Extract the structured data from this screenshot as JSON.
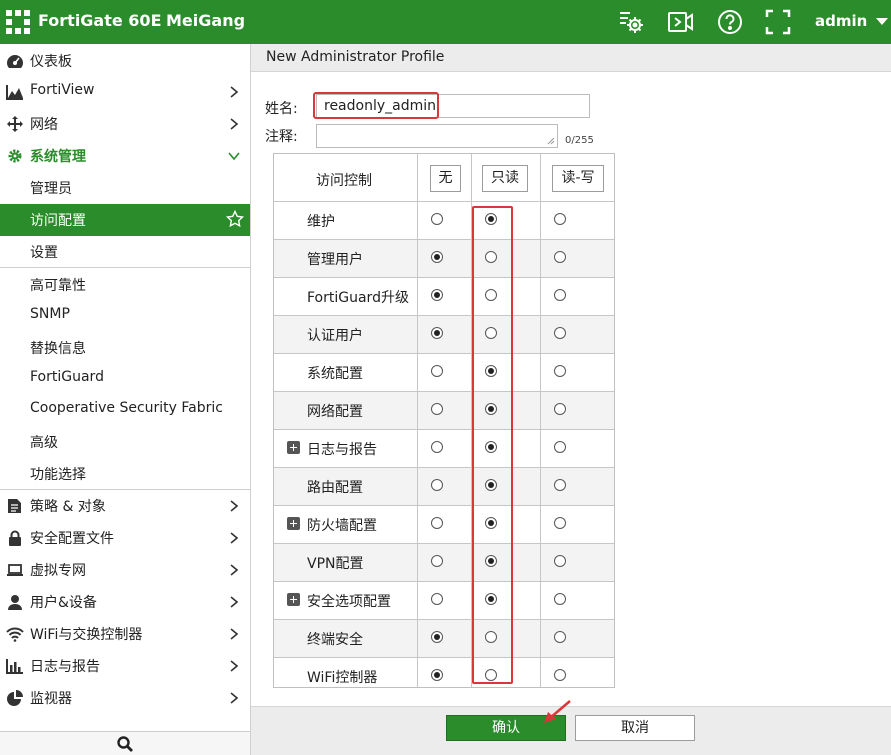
{
  "colors": {
    "brand": "#2a8c2a",
    "highlight": "#d9373a"
  },
  "topbar": {
    "product": "FortiGate 60E",
    "hostname": "MeiGang",
    "user": "admin",
    "icons": [
      "cli-console-icon",
      "fullscreen-video-icon",
      "help-icon",
      "expand-icon"
    ]
  },
  "sidebar": {
    "items": [
      {
        "label": "仪表板",
        "icon": "dashboard-icon",
        "chevron": false
      },
      {
        "label": "FortiView",
        "icon": "chart-icon",
        "chevron": true
      },
      {
        "label": "网络",
        "icon": "move-arrows-icon",
        "chevron": true
      },
      {
        "label": "系统管理",
        "icon": "gear-icon",
        "chevron": true,
        "expanded": true
      }
    ],
    "system_sub": [
      "管理员",
      "访问配置",
      "设置",
      "高可靠性",
      "SNMP",
      "替换信息",
      "FortiGuard",
      "Cooperative Security Fabric",
      "高级",
      "功能选择"
    ],
    "more_items": [
      {
        "label": "策略 & 对象",
        "icon": "policy-icon"
      },
      {
        "label": "安全配置文件",
        "icon": "lock-icon"
      },
      {
        "label": "虚拟专网",
        "icon": "laptop-icon"
      },
      {
        "label": "用户&设备",
        "icon": "user-icon"
      },
      {
        "label": "WiFi与交换控制器",
        "icon": "wifi-icon"
      },
      {
        "label": "日志与报告",
        "icon": "bar-chart-icon"
      },
      {
        "label": "监视器",
        "icon": "pie-chart-icon"
      }
    ]
  },
  "page": {
    "title": "New Administrator Profile",
    "name_label": "姓名:",
    "name_value": "readonly_admin",
    "comment_label": "注释:",
    "char_count": "0/255"
  },
  "table": {
    "header": {
      "label": "访问控制",
      "none": "无",
      "readonly": "只读",
      "readwrite": "读-写"
    },
    "rows": [
      {
        "label": "维护",
        "value": "readonly",
        "expand": false
      },
      {
        "label": "管理用户",
        "value": "none",
        "expand": false
      },
      {
        "label": "FortiGuard升级",
        "value": "none",
        "expand": false
      },
      {
        "label": "认证用户",
        "value": "none",
        "expand": false
      },
      {
        "label": "系统配置",
        "value": "readonly",
        "expand": false
      },
      {
        "label": "网络配置",
        "value": "readonly",
        "expand": false
      },
      {
        "label": "日志与报告",
        "value": "readonly",
        "expand": true
      },
      {
        "label": "路由配置",
        "value": "readonly",
        "expand": false
      },
      {
        "label": "防火墙配置",
        "value": "readonly",
        "expand": true
      },
      {
        "label": "VPN配置",
        "value": "readonly",
        "expand": false
      },
      {
        "label": "安全选项配置",
        "value": "readonly",
        "expand": true
      },
      {
        "label": "终端安全",
        "value": "none",
        "expand": false
      },
      {
        "label": "WiFi控制器",
        "value": "none",
        "expand": false
      }
    ]
  },
  "footer": {
    "ok": "确认",
    "cancel": "取消"
  }
}
